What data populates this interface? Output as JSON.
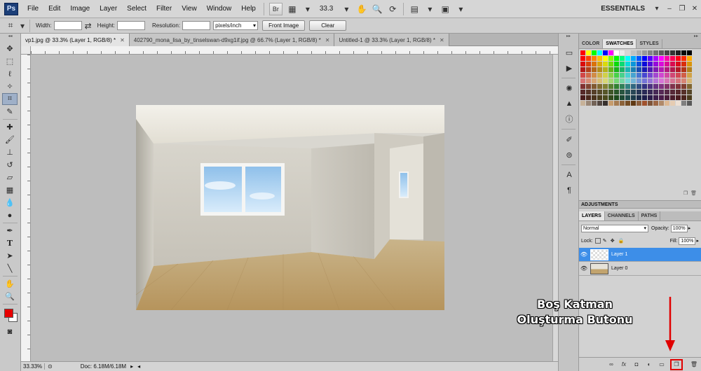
{
  "menubar": {
    "logo": "Ps",
    "items": [
      "File",
      "Edit",
      "Image",
      "Layer",
      "Select",
      "Filter",
      "View",
      "Window",
      "Help"
    ],
    "bridge_label": "Br",
    "zoom": "33.3",
    "workspace": "ESSENTIALS"
  },
  "options": {
    "width_label": "Width:",
    "height_label": "Height:",
    "resolution_label": "Resolution:",
    "resolution_unit": "pixels/inch",
    "front_image_label": "Front Image",
    "clear_label": "Clear"
  },
  "tabs": [
    {
      "title": "vp1.jpg @ 33.3% (Layer 1, RGB/8) *",
      "active": true
    },
    {
      "title": "402790_mona_lisa_by_tinselswan-d9xg1if.jpg @ 66.7% (Layer 1, RGB/8) *",
      "active": false
    },
    {
      "title": "Untitled-1 @ 33.3% (Layer 1, RGB/8) *",
      "active": false
    }
  ],
  "status": {
    "zoom": "33.33%",
    "doc": "Doc: 6.18M/6.18M"
  },
  "swatches_panel": {
    "tabs": [
      "COLOR",
      "SWATCHES",
      "STYLES"
    ],
    "active": "SWATCHES"
  },
  "adjustments_label": "ADJUSTMENTS",
  "layers_panel": {
    "tabs": [
      "LAYERS",
      "CHANNELS",
      "PATHS"
    ],
    "blend_mode": "Normal",
    "opacity_label": "Opacity:",
    "opacity": "100%",
    "lock_label": "Lock:",
    "fill_label": "Fill:",
    "fill": "100%",
    "layers": [
      {
        "name": "Layer 1",
        "selected": true
      },
      {
        "name": "Layer 0",
        "selected": false
      }
    ]
  },
  "annotation": {
    "line1": "Boş Katman",
    "line2": "Oluşturma Butonu",
    "color": "#e00000"
  },
  "colors": {
    "foreground": "#e80000",
    "background": "#ffffff",
    "selection": "#3d8ee8"
  }
}
